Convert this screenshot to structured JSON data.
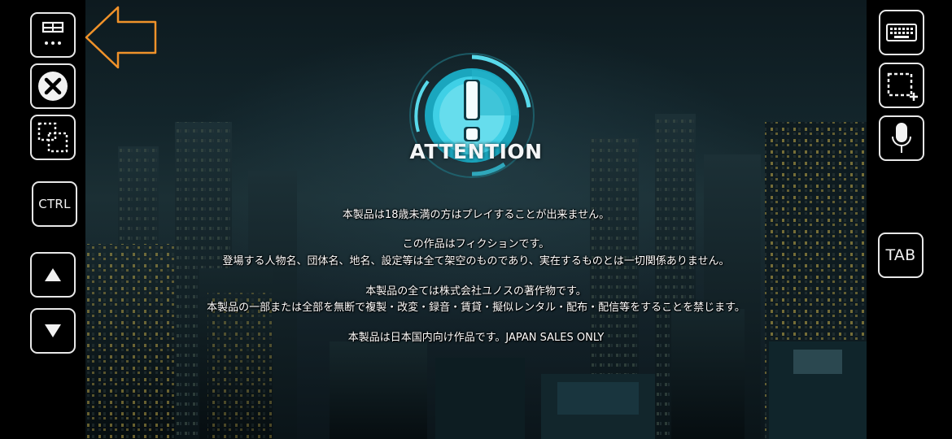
{
  "left_toolbar": {
    "menu_icon": "window-menu-icon",
    "close_icon": "close-circle-icon",
    "dotted_square_icon": "dotted-squares-icon",
    "ctrl_label": "CTRL",
    "up_icon": "triangle-up-icon",
    "down_icon": "triangle-down-icon",
    "arrow_hint_color": "#f0922a"
  },
  "right_toolbar": {
    "keyboard_icon": "keyboard-icon",
    "selection_icon": "selection-plus-icon",
    "mic_icon": "microphone-icon",
    "tab_label": "TAB"
  },
  "game": {
    "title": "ATTENTION",
    "accent_color": "#3fd0e6",
    "lines": {
      "l1": "本製品は18歳未満の方はプレイすることが出来ません。",
      "l2": "この作品はフィクションです。",
      "l3": "登場する人物名、団体名、地名、設定等は全て架空のものであり、実在するものとは一切関係ありません。",
      "l4": "本製品の全ては株式会社ユノスの著作物です。",
      "l5": "本製品の一部または全部を無断で複製・改変・録音・賃貸・擬似レンタル・配布・配信等をすることを禁じます。",
      "l6": "本製品は日本国内向け作品です。JAPAN SALES ONLY"
    }
  }
}
